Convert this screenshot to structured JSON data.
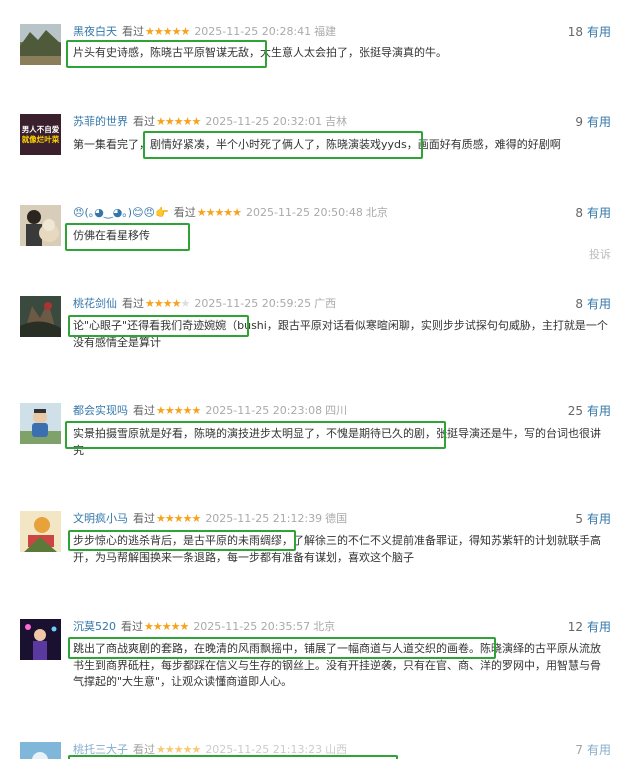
{
  "useful_label": "有用",
  "seen_label": "看过",
  "report_label": "投诉",
  "reviews": [
    {
      "name": "黑夜白天",
      "stars": 5,
      "time": "2025-11-25 20:28:41",
      "location": "福建",
      "votes": "18",
      "comment": "片头有史诗感，陈晓古平原智谋无敌，大生意人太会拍了，张挺导演真的牛。",
      "avatar": "landscape-photo"
    },
    {
      "name": "苏菲的世界",
      "stars": 5,
      "time": "2025-11-25 20:32:01",
      "location": "吉林",
      "votes": "9",
      "comment": "第一集看完了，剧情好紧凑，半个小时死了俩人了，陈晓演装戏yyds，画面好有质感，难得的好剧啊",
      "avatar": "text-avatar",
      "avatar_text_1": "男人不自爱",
      "avatar_text_2": "就像烂叶菜"
    },
    {
      "name": "😠(｡◕‿◕｡)😊😠👉",
      "stars": 5,
      "time": "2025-11-25 20:50:48",
      "location": "北京",
      "votes": "8",
      "comment": "仿佛在看星移传",
      "avatar": "person-with-dog"
    },
    {
      "name": "桃花剑仙",
      "stars": 4,
      "time": "2025-11-25 20:59:25",
      "location": "广西",
      "votes": "8",
      "comment": "论\"心眼子\"还得看我们奇迹婉婉（bushi，跟古平原对话看似寒暄闲聊，实则步步试探句句威胁，主打就是一个没有感情全是算计",
      "avatar": "fantasy-art"
    },
    {
      "name": "都会实现吗",
      "stars": 5,
      "time": "2025-11-25 20:23:08",
      "location": "四川",
      "votes": "25",
      "comment": "实景拍摄雪原就是好看，陈晓的演技进步太明显了，不愧是期待已久的剧，张挺导演还是牛，写的台词也很讲究",
      "avatar": "child-photo"
    },
    {
      "name": "文明疯小马",
      "stars": 5,
      "time": "2025-11-25 21:12:39",
      "location": "德国",
      "votes": "5",
      "comment": "步步惊心的逃杀背后，是古平原的未雨绸缪，了解徐三的不仁不义提前准备罪证，得知苏紫轩的计划就联手高开，为马帮解围换来一条退路，每一步都有准备有谋划，喜欢这个脑子",
      "avatar": "cartoon-art"
    },
    {
      "name": "沉莫520",
      "stars": 5,
      "time": "2025-11-25 20:35:57",
      "location": "北京",
      "votes": "12",
      "comment": "跳出了商战爽剧的套路，在晚清的风雨飘摇中，铺展了一幅商道与人道交织的画卷。陈晓演绎的古平原从流放书生到商界砥柱，每步都踩在信义与生存的钢丝上。没有开挂逆袭，只有在官、商、洋的罗网中，用智慧与骨气撑起的\"大生意\"，让观众读懂商道即人心。",
      "avatar": "concert-photo"
    },
    {
      "name": "桃托三大子",
      "stars": 5,
      "time": "2025-11-25 21:13:23",
      "location": "山西",
      "votes": "7",
      "comment": "",
      "avatar": "blue-art"
    }
  ]
}
